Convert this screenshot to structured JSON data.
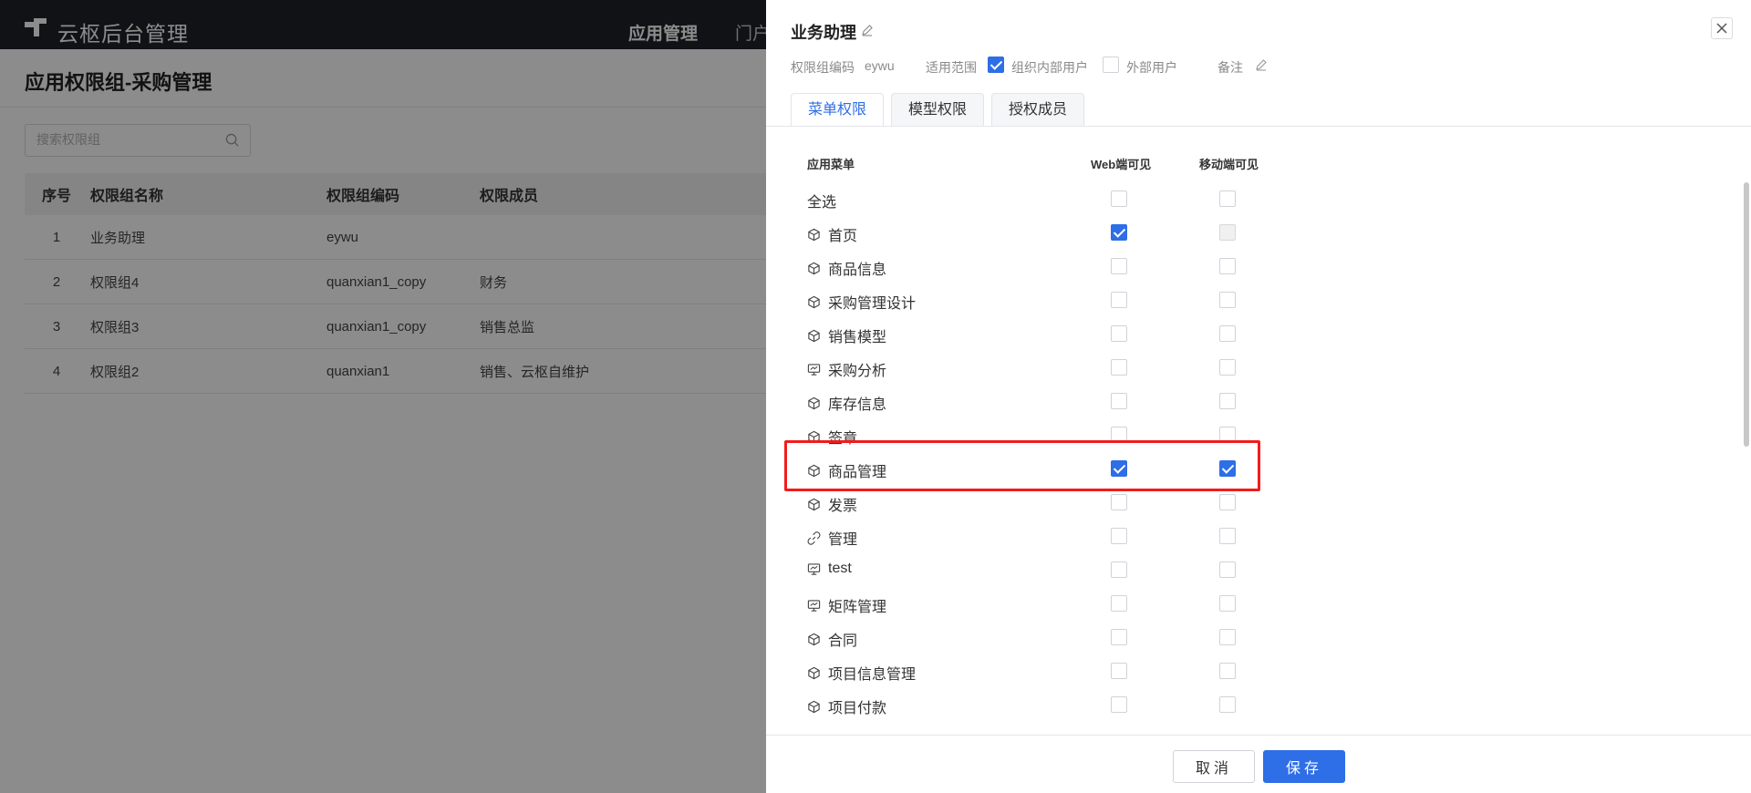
{
  "app": {
    "title": "云枢后台管理",
    "nav": [
      "应用管理",
      "门户"
    ]
  },
  "page": {
    "title": "应用权限组-采购管理",
    "search_placeholder": "搜索权限组"
  },
  "table": {
    "headers": [
      "序号",
      "权限组名称",
      "权限组编码",
      "权限成员"
    ],
    "rows": [
      {
        "index": "1",
        "name": "业务助理",
        "code": "eywu",
        "members": ""
      },
      {
        "index": "2",
        "name": "权限组4",
        "code": "quanxian1_copy",
        "members": "财务"
      },
      {
        "index": "3",
        "name": "权限组3",
        "code": "quanxian1_copy",
        "members": "销售总监"
      },
      {
        "index": "4",
        "name": "权限组2",
        "code": "quanxian1",
        "members": "销售、云枢自维护"
      }
    ]
  },
  "drawer": {
    "title": "业务助理",
    "code_label": "权限组编码",
    "code_value": "eywu",
    "scope_label": "适用范围",
    "scope_internal": "组织内部用户",
    "scope_external": "外部用户",
    "remark_label": "备注",
    "tabs": [
      "菜单权限",
      "模型权限",
      "授权成员"
    ],
    "columns": {
      "menu": "应用菜单",
      "web": "Web端可见",
      "mobile": "移动端可见"
    },
    "select_all": "全选",
    "menus": [
      {
        "label": "首页",
        "icon": "cube-icon",
        "web": true,
        "mobile": false,
        "mobile_disabled": true
      },
      {
        "label": "商品信息",
        "icon": "cube-icon",
        "web": false,
        "mobile": false
      },
      {
        "label": "采购管理设计",
        "icon": "cube-icon",
        "web": false,
        "mobile": false
      },
      {
        "label": "销售模型",
        "icon": "cube-icon",
        "web": false,
        "mobile": false
      },
      {
        "label": "采购分析",
        "icon": "monitor-icon",
        "web": false,
        "mobile": false
      },
      {
        "label": "库存信息",
        "icon": "cube-icon",
        "web": false,
        "mobile": false
      },
      {
        "label": "签章",
        "icon": "cube-icon",
        "web": false,
        "mobile": false
      },
      {
        "label": "商品管理",
        "icon": "cube-icon",
        "web": true,
        "mobile": true
      },
      {
        "label": "发票",
        "icon": "cube-icon",
        "web": false,
        "mobile": false
      },
      {
        "label": "管理",
        "icon": "link-icon",
        "web": false,
        "mobile": false
      },
      {
        "label": "test",
        "icon": "monitor-icon",
        "web": false,
        "mobile": false
      },
      {
        "label": "矩阵管理",
        "icon": "monitor-icon",
        "web": false,
        "mobile": false
      },
      {
        "label": "合同",
        "icon": "cube-icon",
        "web": false,
        "mobile": false
      },
      {
        "label": "项目信息管理",
        "icon": "cube-icon",
        "web": false,
        "mobile": false
      },
      {
        "label": "项目付款",
        "icon": "cube-icon",
        "web": false,
        "mobile": false
      }
    ],
    "cancel_label": "取消",
    "save_label": "保存"
  },
  "colors": {
    "accent": "#2e6ee6",
    "highlight": "#f21c1c"
  }
}
